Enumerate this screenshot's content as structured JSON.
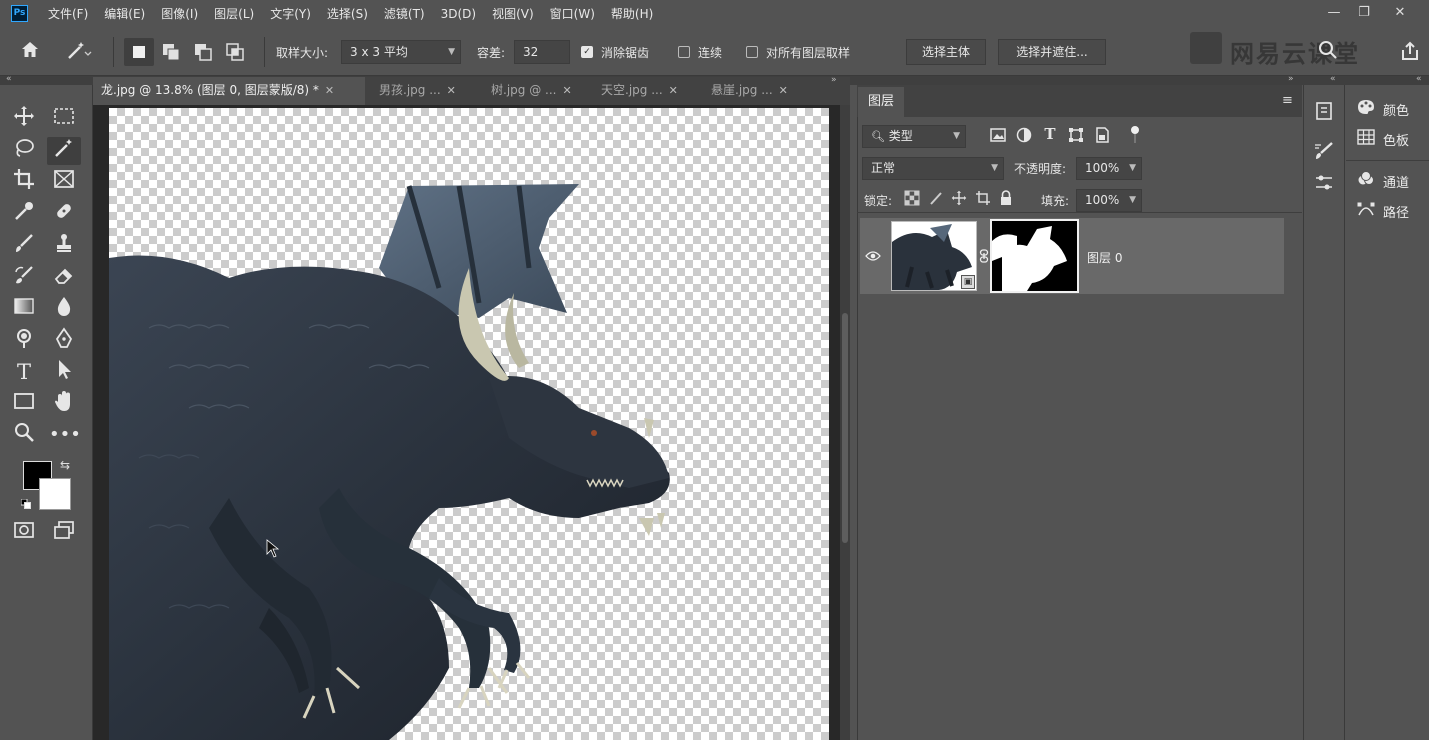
{
  "app": {
    "logo_text": "Ps"
  },
  "menu": [
    "文件(F)",
    "编辑(E)",
    "图像(I)",
    "图层(L)",
    "文字(Y)",
    "选择(S)",
    "滤镜(T)",
    "3D(D)",
    "视图(V)",
    "窗口(W)",
    "帮助(H)"
  ],
  "window_controls": {
    "minimize": "—",
    "restore": "❐",
    "close": "✕"
  },
  "options": {
    "sample_size_label": "取样大小:",
    "sample_size_value": "3 x 3 平均",
    "tolerance_label": "容差:",
    "tolerance_value": "32",
    "anti_alias_label": "消除锯齿",
    "anti_alias_checked": true,
    "contiguous_label": "连续",
    "contiguous_checked": false,
    "sample_all_label": "对所有图层取样",
    "sample_all_checked": false,
    "select_subject_label": "选择主体",
    "select_mask_label": "选择并遮住..."
  },
  "brand_watermark": "网易云课堂",
  "doc_tabs": [
    {
      "label": "龙.jpg @ 13.8% (图层 0, 图层蒙版/8) *",
      "active": true
    },
    {
      "label": "男孩.jpg ...",
      "active": false
    },
    {
      "label": "树.jpg @ ...",
      "active": false
    },
    {
      "label": "天空.jpg ...",
      "active": false
    },
    {
      "label": "悬崖.jpg ...",
      "active": false
    }
  ],
  "layers_panel": {
    "tab_label": "图层",
    "filter_label": "类型",
    "blend_mode": "正常",
    "opacity_label": "不透明度:",
    "opacity_value": "100%",
    "lock_label": "锁定:",
    "fill_label": "填充:",
    "fill_value": "100%",
    "layers": [
      {
        "name": "图层 0",
        "visible": true,
        "has_mask": true
      }
    ]
  },
  "right_dock": [
    {
      "label": "颜色",
      "icon": "palette-icon"
    },
    {
      "label": "色板",
      "icon": "swatches-grid-icon"
    },
    {
      "label": "通道",
      "icon": "channels-icon"
    },
    {
      "label": "路径",
      "icon": "paths-icon"
    }
  ],
  "colors": {
    "foreground": "#000000",
    "background": "#ffffff",
    "ui_bg": "#535353",
    "ui_dark": "#3f3f3f",
    "layer_selected": "#696969"
  }
}
